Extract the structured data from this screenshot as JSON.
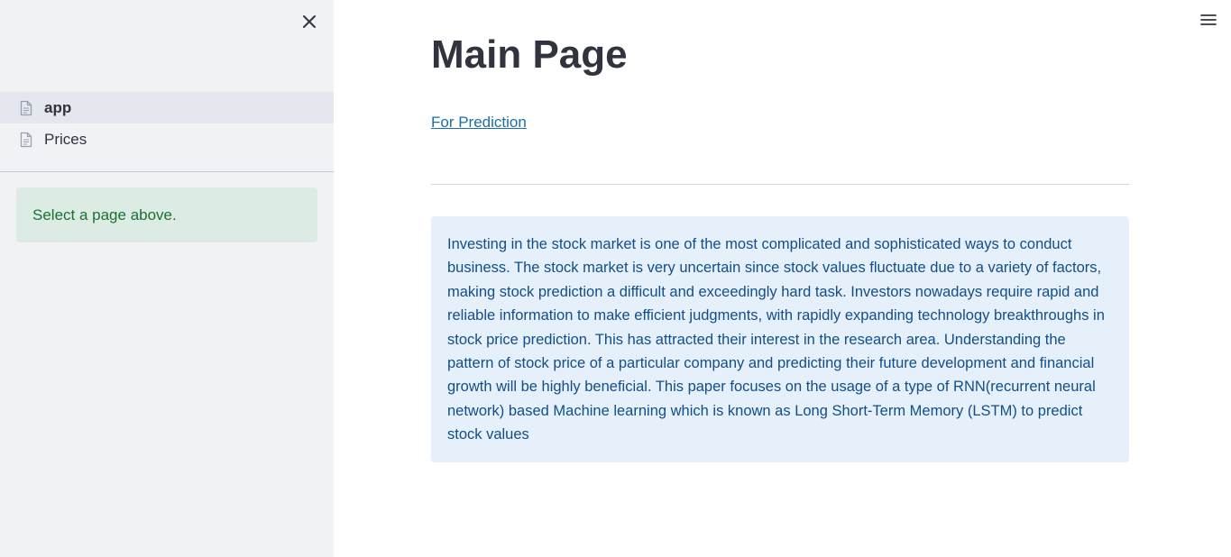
{
  "sidebar": {
    "close_icon": "close-icon",
    "items": [
      {
        "label": "app",
        "icon": "document-icon",
        "active": true
      },
      {
        "label": "Prices",
        "icon": "document-icon",
        "active": false
      }
    ],
    "alert": {
      "text": "Select a page above.",
      "color": "#177233",
      "background": "#dcebe4"
    }
  },
  "header": {
    "menu_icon": "hamburger-menu-icon"
  },
  "main": {
    "title": "Main Page",
    "link_label": "For Prediction",
    "info_text": "Investing in the stock market is one of the most complicated and sophisticated ways to conduct business. The stock market is very uncertain since stock values fluctuate due to a variety of factors, making stock prediction a difficult and exceedingly hard task. Investors nowadays require rapid and reliable information to make efficient judgments, with rapidly expanding technology breakthroughs in stock price prediction. This has attracted their interest in the research area. Understanding the pattern of stock price of a particular company and predicting their future development and financial growth will be highly beneficial. This paper focuses on the usage of a type of RNN(recurrent neural network) based Machine learning which is known as Long Short-Term Memory (LSTM) to predict stock values"
  },
  "colors": {
    "sidebar_bg": "#f0f2f6",
    "link": "#1c6fa8",
    "info_bg": "#e6f0fa",
    "info_text": "#124e89"
  }
}
